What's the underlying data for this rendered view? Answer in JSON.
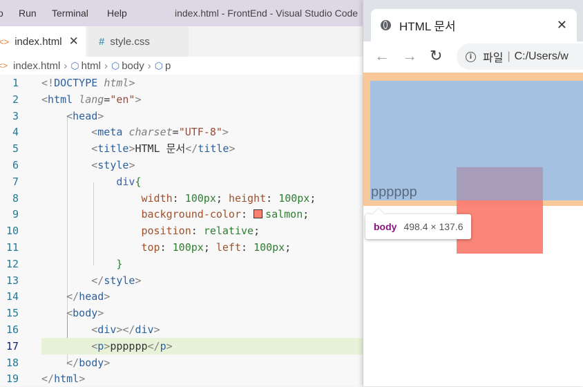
{
  "vscode": {
    "menu": [
      "o",
      "Run",
      "Terminal",
      "Help"
    ],
    "window_title": "index.html - FrontEnd - Visual Studio Code",
    "tabs": [
      {
        "label": "index.html",
        "icon": "html-file-icon",
        "active": true
      },
      {
        "label": "style.css",
        "icon": "css-file-icon",
        "active": false
      }
    ],
    "breadcrumbs": [
      "index.html",
      "html",
      "body",
      "p"
    ],
    "code_lines": [
      {
        "num": "1",
        "tokens": [
          [
            "t-punc",
            "<!"
          ],
          [
            "t-tag",
            "DOCTYPE"
          ],
          [
            "t-txt",
            " "
          ],
          [
            "t-attr",
            "html"
          ],
          [
            "t-punc",
            ">"
          ]
        ]
      },
      {
        "num": "2",
        "tokens": [
          [
            "t-punc",
            "<"
          ],
          [
            "t-tag",
            "html"
          ],
          [
            "t-txt",
            " "
          ],
          [
            "t-attr",
            "lang"
          ],
          [
            "t-txt",
            "="
          ],
          [
            "t-str",
            "\"en\""
          ],
          [
            "t-punc",
            ">"
          ]
        ]
      },
      {
        "num": "3",
        "tokens": [
          [
            "t-txt",
            "    "
          ],
          [
            "t-punc",
            "<"
          ],
          [
            "t-tag",
            "head"
          ],
          [
            "t-punc",
            ">"
          ]
        ]
      },
      {
        "num": "4",
        "tokens": [
          [
            "t-txt",
            "        "
          ],
          [
            "t-punc",
            "<"
          ],
          [
            "t-tag",
            "meta"
          ],
          [
            "t-txt",
            " "
          ],
          [
            "t-attr",
            "charset"
          ],
          [
            "t-txt",
            "="
          ],
          [
            "t-str",
            "\"UTF-8\""
          ],
          [
            "t-punc",
            ">"
          ]
        ]
      },
      {
        "num": "5",
        "tokens": [
          [
            "t-txt",
            "        "
          ],
          [
            "t-punc",
            "<"
          ],
          [
            "t-tag",
            "title"
          ],
          [
            "t-punc",
            ">"
          ],
          [
            "t-txt",
            "HTML 문서"
          ],
          [
            "t-punc",
            "</"
          ],
          [
            "t-tag",
            "title"
          ],
          [
            "t-punc",
            ">"
          ]
        ]
      },
      {
        "num": "6",
        "tokens": [
          [
            "t-txt",
            "        "
          ],
          [
            "t-punc",
            "<"
          ],
          [
            "t-tag",
            "style"
          ],
          [
            "t-punc",
            ">"
          ]
        ]
      },
      {
        "num": "7",
        "tokens": [
          [
            "t-txt",
            "            "
          ],
          [
            "t-sel",
            "div"
          ],
          [
            "t-brace",
            "{"
          ]
        ]
      },
      {
        "num": "8",
        "tokens": [
          [
            "t-txt",
            "                "
          ],
          [
            "t-prop",
            "width"
          ],
          [
            "t-txt",
            ": "
          ],
          [
            "t-num",
            "100px"
          ],
          [
            "t-txt",
            "; "
          ],
          [
            "t-prop",
            "height"
          ],
          [
            "t-txt",
            ": "
          ],
          [
            "t-num",
            "100px"
          ],
          [
            "t-txt",
            ";"
          ]
        ]
      },
      {
        "num": "9",
        "tokens": [
          [
            "t-txt",
            "                "
          ],
          [
            "t-prop",
            "background-color"
          ],
          [
            "t-txt",
            ": "
          ],
          [
            "swatch",
            ""
          ],
          [
            "t-val",
            "salmon"
          ],
          [
            "t-txt",
            ";"
          ]
        ]
      },
      {
        "num": "10",
        "tokens": [
          [
            "t-txt",
            "                "
          ],
          [
            "t-prop",
            "position"
          ],
          [
            "t-txt",
            ": "
          ],
          [
            "t-val",
            "relative"
          ],
          [
            "t-txt",
            ";"
          ]
        ]
      },
      {
        "num": "11",
        "tokens": [
          [
            "t-txt",
            "                "
          ],
          [
            "t-prop",
            "top"
          ],
          [
            "t-txt",
            ": "
          ],
          [
            "t-num",
            "100px"
          ],
          [
            "t-txt",
            "; "
          ],
          [
            "t-prop",
            "left"
          ],
          [
            "t-txt",
            ": "
          ],
          [
            "t-num",
            "100px"
          ],
          [
            "t-txt",
            ";"
          ]
        ]
      },
      {
        "num": "12",
        "tokens": [
          [
            "t-txt",
            "            "
          ],
          [
            "t-brace",
            "}"
          ]
        ]
      },
      {
        "num": "13",
        "tokens": [
          [
            "t-txt",
            "        "
          ],
          [
            "t-punc",
            "</"
          ],
          [
            "t-tag",
            "style"
          ],
          [
            "t-punc",
            ">"
          ]
        ]
      },
      {
        "num": "14",
        "tokens": [
          [
            "t-txt",
            "    "
          ],
          [
            "t-punc",
            "</"
          ],
          [
            "t-tag",
            "head"
          ],
          [
            "t-punc",
            ">"
          ]
        ]
      },
      {
        "num": "15",
        "tokens": [
          [
            "t-txt",
            "    "
          ],
          [
            "t-punc",
            "<"
          ],
          [
            "t-tag",
            "body"
          ],
          [
            "t-punc",
            ">"
          ]
        ]
      },
      {
        "num": "16",
        "tokens": [
          [
            "t-txt",
            "        "
          ],
          [
            "t-punc",
            "<"
          ],
          [
            "t-tag",
            "div"
          ],
          [
            "t-punc",
            "></"
          ],
          [
            "t-tag",
            "div"
          ],
          [
            "t-punc",
            ">"
          ]
        ]
      },
      {
        "num": "17",
        "current": true,
        "tokens": [
          [
            "t-txt",
            "        "
          ],
          [
            "t-punc",
            "<"
          ],
          [
            "t-tag",
            "p"
          ],
          [
            "t-punc",
            ">"
          ],
          [
            "t-txt",
            "pppppp"
          ],
          [
            "t-punc",
            "</"
          ],
          [
            "t-tag",
            "p"
          ],
          [
            "t-punc",
            ">"
          ]
        ]
      },
      {
        "num": "18",
        "tokens": [
          [
            "t-txt",
            "    "
          ],
          [
            "t-punc",
            "</"
          ],
          [
            "t-tag",
            "body"
          ],
          [
            "t-punc",
            ">"
          ]
        ]
      },
      {
        "num": "19",
        "tokens": [
          [
            "t-punc",
            "</"
          ],
          [
            "t-tag",
            "html"
          ],
          [
            "t-punc",
            ">"
          ]
        ]
      }
    ]
  },
  "browser": {
    "tab_title": "HTML 문서",
    "tab_close": "✕",
    "back": "←",
    "forward": "→",
    "reload": "↻",
    "info": "i",
    "address_label": "파일",
    "address_url": "C:/Users/w",
    "page_text": "pppppp",
    "inspect_tag": "body",
    "inspect_dims": "498.4 × 137.6"
  },
  "colors": {
    "salmon": "#fa8072",
    "margin_highlight": "#f7c89a",
    "content_highlight": "#a4c1e2"
  }
}
